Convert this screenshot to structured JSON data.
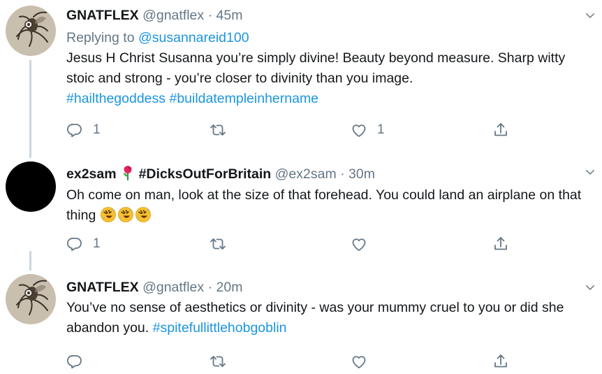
{
  "tweets": [
    {
      "name": "GNATFLEX",
      "handle": "@gnatflex",
      "separator": "·",
      "time": "45m",
      "replying_prefix": "Replying to",
      "replying_to": "@susannareid100",
      "text": "Jesus H Christ Susanna you’re simply divine! Beauty beyond measure. Sharp witty stoic and strong - you’re closer to divinity than you image.",
      "hashtags": [
        "#hailthegoddess",
        "#buildatempleinhername"
      ],
      "reply_count": "1",
      "retweet_count": "",
      "like_count": "1"
    },
    {
      "name": "ex2sam",
      "badge_icon": "rose-emoji",
      "display_tag": "#DicksOutForBritain",
      "handle": "@ex2sam",
      "separator": "·",
      "time": "30m",
      "text": "Oh come on man, look at the size of that forehead. You could land an airplane on that thing",
      "emojis": [
        "rolling-on-floor-laughing-emoji",
        "rolling-on-floor-laughing-emoji",
        "rolling-on-floor-laughing-emoji"
      ],
      "reply_count": "1",
      "retweet_count": "",
      "like_count": ""
    },
    {
      "name": "GNATFLEX",
      "handle": "@gnatflex",
      "separator": "·",
      "time": "20m",
      "text": "You’ve no sense of aesthetics or divinity - was your mummy cruel to you or did she abandon you.",
      "hashtags": [
        "#spitefullittlehobgoblin"
      ],
      "reply_count": "",
      "retweet_count": "",
      "like_count": ""
    }
  ],
  "icons": {
    "reply": "reply-icon",
    "retweet": "retweet-icon",
    "like": "like-icon",
    "share": "share-icon",
    "more": "chevron-down-icon"
  },
  "colors": {
    "link": "#1b95e0",
    "muted": "#657786",
    "text": "#14171a",
    "thread_line": "#ccd6dd"
  }
}
